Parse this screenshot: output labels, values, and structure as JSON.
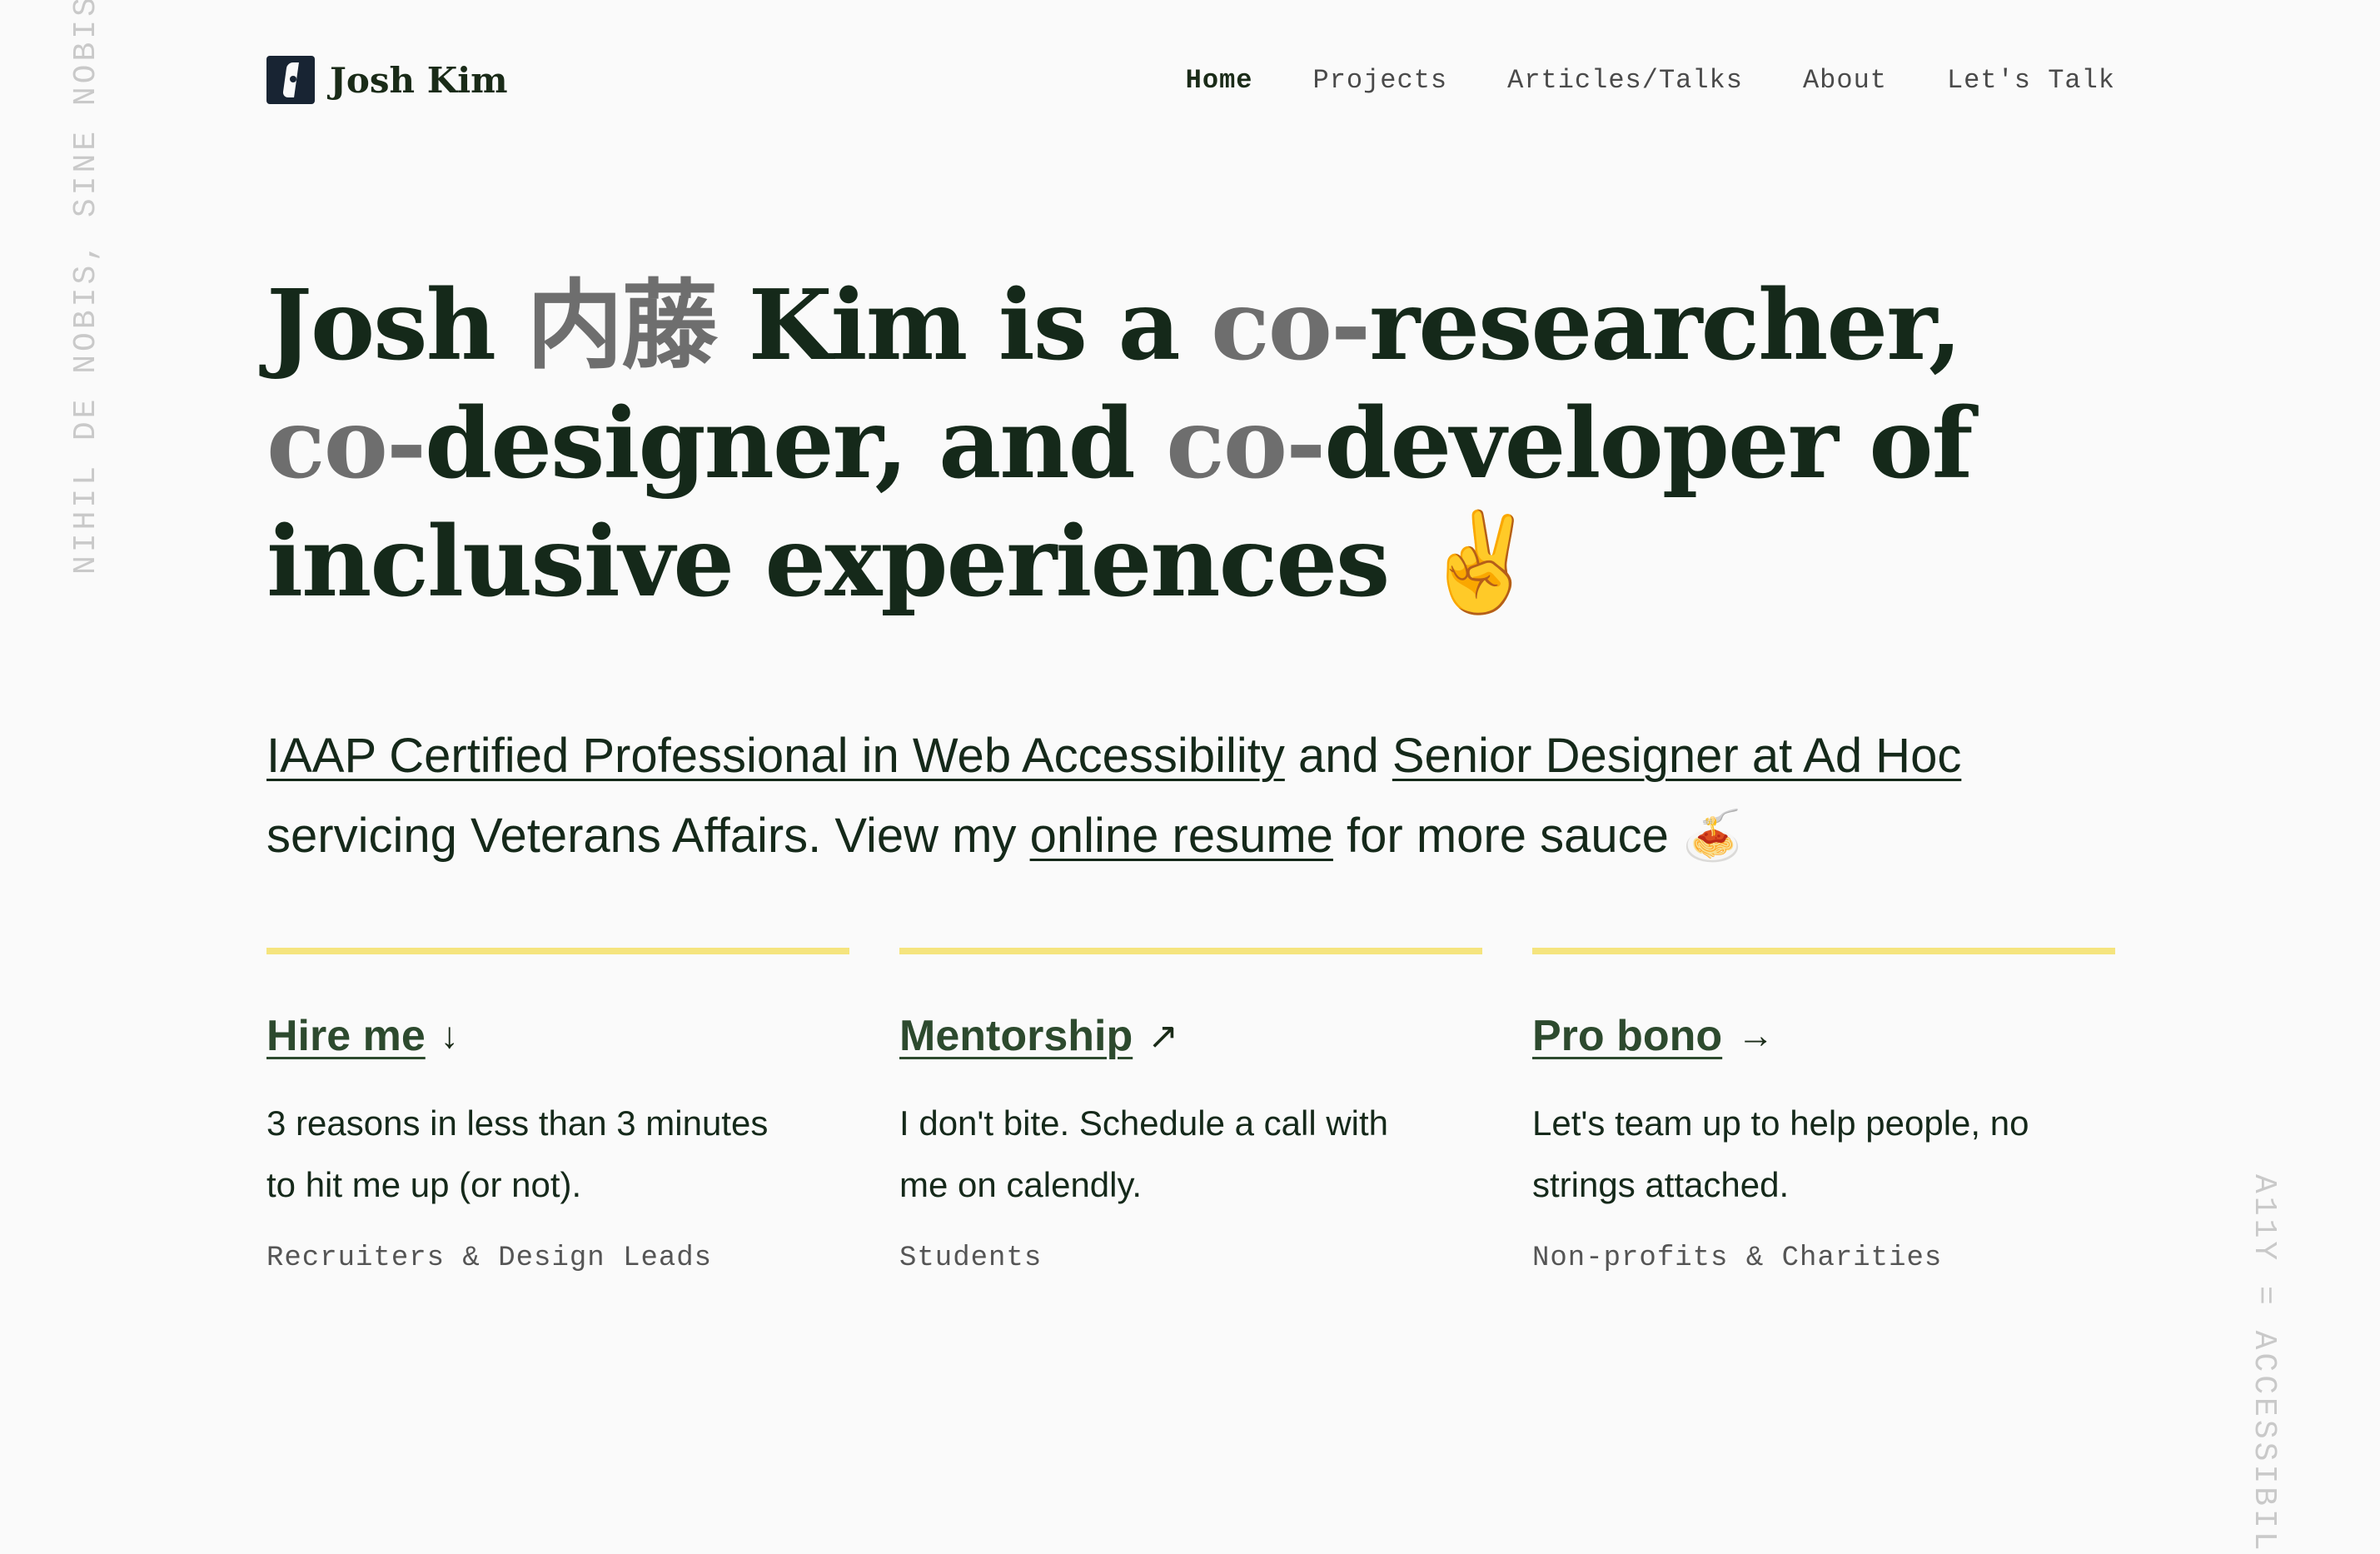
{
  "side": {
    "left_text": "NIHIL DE NOBIS, SINE NOBIS",
    "right_text": "A11Y = ACCESSIBIL"
  },
  "brand": {
    "name": "Josh Kim",
    "logo_icon": "jk-logo-icon"
  },
  "nav": {
    "items": [
      {
        "label": "Home",
        "active": true
      },
      {
        "label": "Projects",
        "active": false
      },
      {
        "label": "Articles/Talks",
        "active": false
      },
      {
        "label": "About",
        "active": false
      },
      {
        "label": "Let's Talk",
        "active": false
      }
    ]
  },
  "hero": {
    "p1": "Josh ",
    "kanji": "内藤",
    "p2": " Kim is a ",
    "co1": "co-",
    "p3": "researcher, ",
    "co2": "co-",
    "p4": "designer, and ",
    "co3": "co-",
    "p5": "developer of inclusive experiences ",
    "emoji": "✌️"
  },
  "intro": {
    "link1": "IAAP Certified Professional in Web Accessibility",
    "t1": " and ",
    "link2": "Senior Designer at Ad Hoc",
    "t2": " servicing Veterans Affairs. View my ",
    "link3": "online resume",
    "t3": " for more sauce ",
    "emoji": "🍝"
  },
  "cards": [
    {
      "title": "Hire me ",
      "arrow": "↓",
      "arrow_icon": "arrow-down-icon",
      "desc": "3 reasons in less than 3 minutes to hit me up (or not).",
      "tag": "Recruiters & Design Leads"
    },
    {
      "title": "Mentorship ",
      "arrow": "↗",
      "arrow_icon": "arrow-up-right-icon",
      "desc": "I don't bite. Schedule a call with me on calendly.",
      "tag": "Students"
    },
    {
      "title": "Pro bono ",
      "arrow": "→",
      "arrow_icon": "arrow-right-icon",
      "desc": "Let's team up to help people, no strings attached.",
      "tag": "Non-profits & Charities"
    }
  ],
  "colors": {
    "accent_rule": "#f5e47e",
    "text": "#15291a",
    "muted": "#6e6e6e",
    "background": "#fafafa"
  }
}
